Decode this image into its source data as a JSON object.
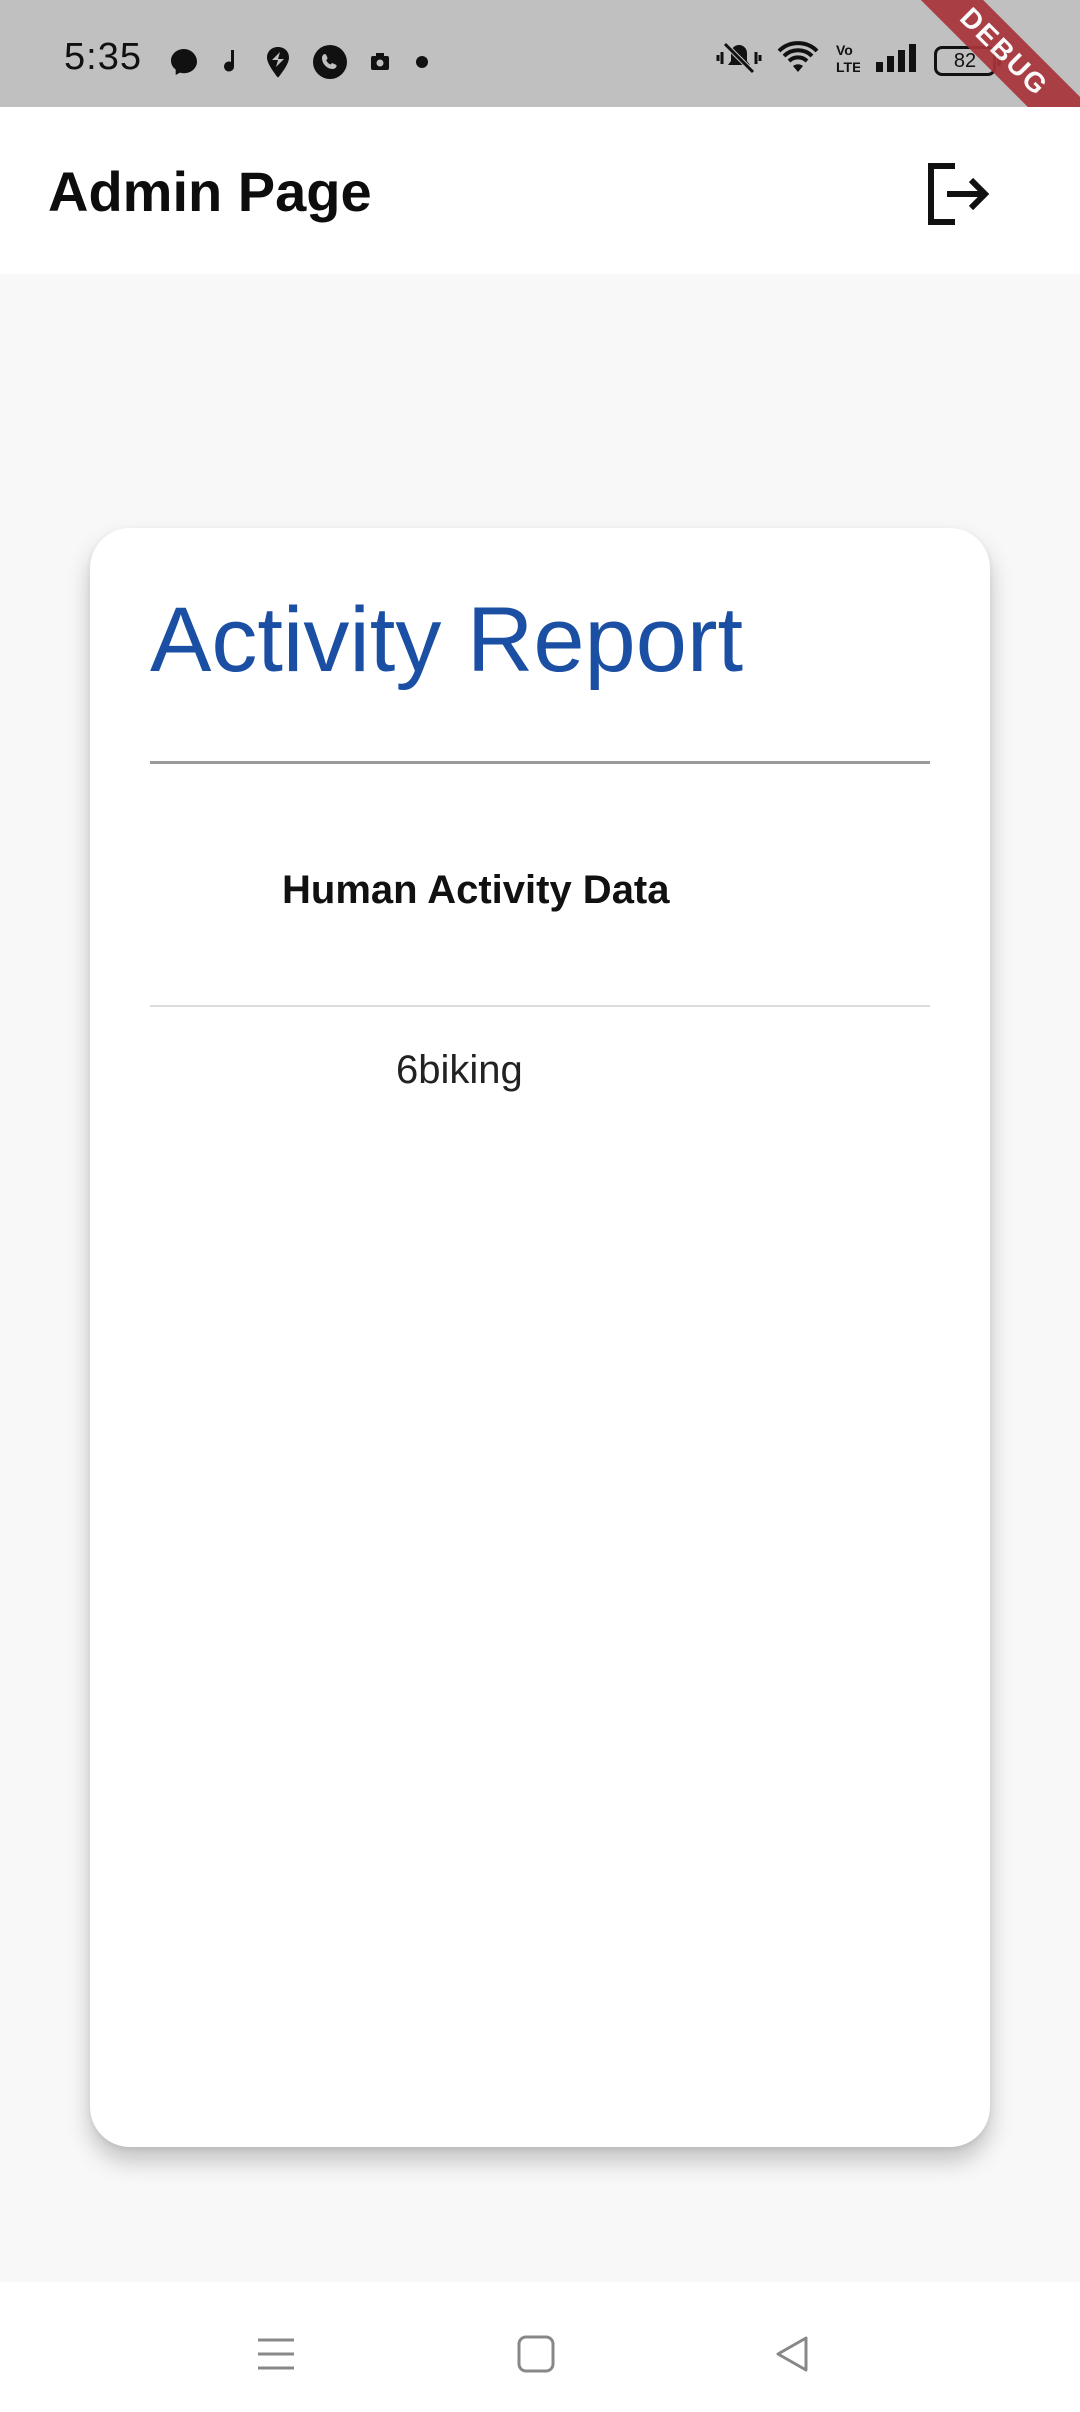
{
  "status_bar": {
    "time": "5:35",
    "battery_level": "82",
    "left_icons": [
      "messenger-icon",
      "music-icon",
      "swiggy-icon",
      "phone-icon",
      "camera-icon",
      "dot-icon"
    ],
    "right_icons": [
      "vibrate-icon",
      "wifi-icon",
      "volte-icon",
      "signal-icon",
      "battery-icon"
    ],
    "debug_label": "DEBUG"
  },
  "app_bar": {
    "title": "Admin Page",
    "logout_icon": "logout-icon"
  },
  "card": {
    "title": "Activity Report",
    "title_color": "#1a4fa3",
    "table": {
      "header": "Human Activity Data",
      "rows": [
        "6biking"
      ]
    }
  },
  "nav_bar": {
    "buttons": [
      "menu-icon",
      "home-icon",
      "back-icon"
    ]
  }
}
